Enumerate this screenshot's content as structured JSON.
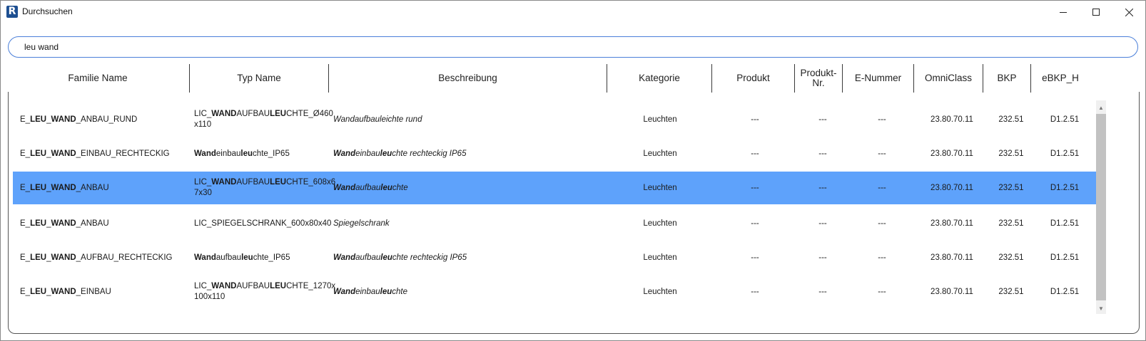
{
  "window": {
    "title": "Durchsuchen",
    "app_icon_letter": "R"
  },
  "search": {
    "value": "leu wand"
  },
  "columns": [
    "Familie Name",
    "Typ Name",
    "Beschreibung",
    "Kategorie",
    "Produkt",
    "Produkt-\nNr.",
    "E-Nummer",
    "OmniClass",
    "BKP",
    "eBKP_H"
  ],
  "rows": [
    {
      "familie": [
        [
          "E_",
          false
        ],
        [
          "LEU",
          true
        ],
        [
          "_",
          false
        ],
        [
          "WAND",
          true
        ],
        [
          "_ANBAU_RUND",
          false
        ]
      ],
      "typ": [
        [
          "LIC_",
          false
        ],
        [
          "WAND",
          true
        ],
        [
          "AUFBAU",
          false
        ],
        [
          "LEU",
          true
        ],
        [
          "CHTE_Ø460\nx110",
          false
        ]
      ],
      "beschreibung": [
        [
          "Wandaufbauleichte rund",
          false
        ]
      ],
      "kategorie": "Leuchten",
      "produkt": "---",
      "produkt_nr": "---",
      "e_nummer": "---",
      "omniclass": "23.80.70.11",
      "bkp": "232.51",
      "ebkp_h": "D1.2.51",
      "selected": false
    },
    {
      "familie": [
        [
          "E_",
          false
        ],
        [
          "LEU",
          true
        ],
        [
          "_",
          false
        ],
        [
          "WAND",
          true
        ],
        [
          "_EINBAU_RECHTECKIG",
          false
        ]
      ],
      "typ": [
        [
          "Wand",
          true
        ],
        [
          "einbau",
          false
        ],
        [
          "leu",
          true
        ],
        [
          "chte_IP65",
          false
        ]
      ],
      "beschreibung": [
        [
          "Wand",
          true
        ],
        [
          "einbau",
          false
        ],
        [
          "leu",
          true
        ],
        [
          "chte rechteckig IP65",
          false
        ]
      ],
      "kategorie": "Leuchten",
      "produkt": "---",
      "produkt_nr": "---",
      "e_nummer": "---",
      "omniclass": "23.80.70.11",
      "bkp": "232.51",
      "ebkp_h": "D1.2.51",
      "selected": false
    },
    {
      "familie": [
        [
          "E_",
          false
        ],
        [
          "LEU",
          true
        ],
        [
          "_",
          false
        ],
        [
          "WAND",
          true
        ],
        [
          "_ANBAU",
          false
        ]
      ],
      "typ": [
        [
          "LIC_",
          false
        ],
        [
          "WAND",
          true
        ],
        [
          "AUFBAU",
          false
        ],
        [
          "LEU",
          true
        ],
        [
          "CHTE_608x6\n7x30",
          false
        ]
      ],
      "beschreibung": [
        [
          "Wand",
          true
        ],
        [
          "aufbau",
          false
        ],
        [
          "leu",
          true
        ],
        [
          "chte",
          false
        ]
      ],
      "kategorie": "Leuchten",
      "produkt": "---",
      "produkt_nr": "---",
      "e_nummer": "---",
      "omniclass": "23.80.70.11",
      "bkp": "232.51",
      "ebkp_h": "D1.2.51",
      "selected": true
    },
    {
      "familie": [
        [
          "E_",
          false
        ],
        [
          "LEU",
          true
        ],
        [
          "_",
          false
        ],
        [
          "WAND",
          true
        ],
        [
          "_ANBAU",
          false
        ]
      ],
      "typ": [
        [
          "LIC_SPIEGELSCHRANK_600x80x40",
          false
        ]
      ],
      "beschreibung": [
        [
          "Spiegelschrank",
          false
        ]
      ],
      "kategorie": "Leuchten",
      "produkt": "---",
      "produkt_nr": "---",
      "e_nummer": "---",
      "omniclass": "23.80.70.11",
      "bkp": "232.51",
      "ebkp_h": "D1.2.51",
      "selected": false
    },
    {
      "familie": [
        [
          "E_",
          false
        ],
        [
          "LEU",
          true
        ],
        [
          "_",
          false
        ],
        [
          "WAND",
          true
        ],
        [
          "_AUFBAU_RECHTECKIG",
          false
        ]
      ],
      "typ": [
        [
          "Wand",
          true
        ],
        [
          "aufbau",
          false
        ],
        [
          "leu",
          true
        ],
        [
          "chte_IP65",
          false
        ]
      ],
      "beschreibung": [
        [
          "Wand",
          true
        ],
        [
          "aufbau",
          false
        ],
        [
          "leu",
          true
        ],
        [
          "chte rechteckig IP65",
          false
        ]
      ],
      "kategorie": "Leuchten",
      "produkt": "---",
      "produkt_nr": "---",
      "e_nummer": "---",
      "omniclass": "23.80.70.11",
      "bkp": "232.51",
      "ebkp_h": "D1.2.51",
      "selected": false
    },
    {
      "familie": [
        [
          "E_",
          false
        ],
        [
          "LEU",
          true
        ],
        [
          "_",
          false
        ],
        [
          "WAND",
          true
        ],
        [
          "_EINBAU",
          false
        ]
      ],
      "typ": [
        [
          "LIC_",
          false
        ],
        [
          "WAND",
          true
        ],
        [
          "AUFBAU",
          false
        ],
        [
          "LEU",
          true
        ],
        [
          "CHTE_1270x\n100x110",
          false
        ]
      ],
      "beschreibung": [
        [
          "Wand",
          true
        ],
        [
          "einbau",
          false
        ],
        [
          "leu",
          true
        ],
        [
          "chte",
          false
        ]
      ],
      "kategorie": "Leuchten",
      "produkt": "---",
      "produkt_nr": "---",
      "e_nummer": "---",
      "omniclass": "23.80.70.11",
      "bkp": "232.51",
      "ebkp_h": "D1.2.51",
      "selected": false
    }
  ],
  "colors": {
    "selection": "#5ea2fb",
    "search_border": "#4a7fd9"
  },
  "icons": {
    "minimize": "minimize-icon",
    "maximize": "maximize-icon",
    "close": "close-icon"
  }
}
